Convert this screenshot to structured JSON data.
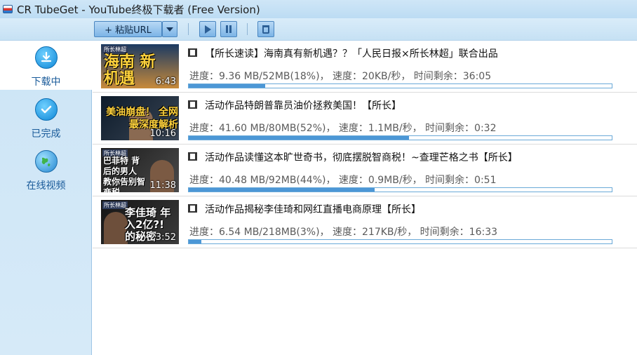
{
  "window": {
    "title": "CR TubeGet - YouTube终极下载者 (Free Version)"
  },
  "toolbar": {
    "paste_label": "+ 粘贴URL"
  },
  "sidebar": {
    "items": [
      {
        "label": "下载中",
        "icon": "download-icon",
        "active": true
      },
      {
        "label": "已完成",
        "icon": "check-icon",
        "active": false
      },
      {
        "label": "在线视频",
        "icon": "globe-icon",
        "active": false
      }
    ]
  },
  "downloads": [
    {
      "title": "【所长速读】海南真有新机遇？？「人民日报×所长林超」联合出品",
      "status": "进度：9.36 MB/52MB(18%)， 速度：20KB/秒， 时间剩余：36:05",
      "progress": 0.18,
      "duration": "6:43",
      "thumb_caption": "海南 新机遇"
    },
    {
      "title": "活动作品特朗普靠员油价拯救美国！【所长】",
      "status": "进度：41.60 MB/80MB(52%)， 速度：1.1MB/秒， 时间剩余：0:32",
      "progress": 0.52,
      "duration": "10:16",
      "thumb_caption": "美油崩盘！ 全网最深度解析"
    },
    {
      "title": "活动作品读懂这本旷世奇书，彻底摆脱智商税！~查理芒格之书【所长】",
      "status": "进度：40.48 MB/92MB(44%)， 速度：0.9MB/秒， 时间剩余：0:51",
      "progress": 0.44,
      "duration": "11:38",
      "thumb_caption": "巴菲特 背后的男人 教你告别智商税"
    },
    {
      "title": "活动作品揭秘李佳琦和网红直播电商原理【所长】",
      "status": "进度：6.54 MB/218MB(3%)， 速度：217KB/秒， 时间剩余：16:33",
      "progress": 0.03,
      "duration": "23:52",
      "thumb_caption": "李佳琦 年入2亿?! 的秘密"
    }
  ],
  "thumb_header": "所长林超",
  "colors": {
    "accent": "#4c97d6",
    "sidebar": "#cde5f6",
    "toolbar_button": "#7cb4e6"
  }
}
